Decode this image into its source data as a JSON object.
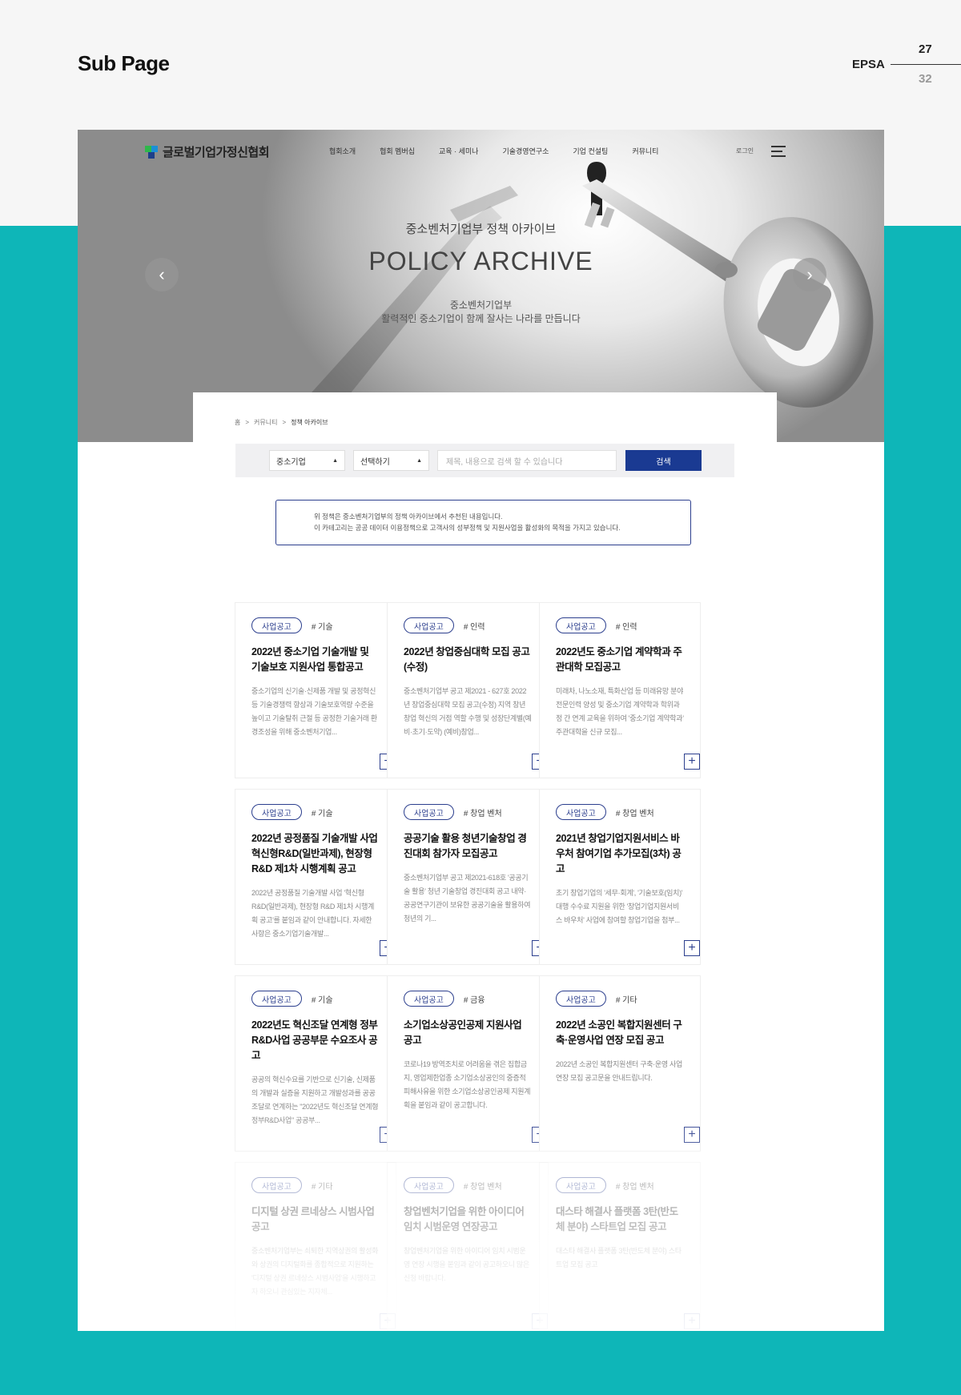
{
  "presentation": {
    "title": "Sub Page",
    "brand": "EPSA",
    "page_current": "27",
    "page_total": "32"
  },
  "site": {
    "logo": "글로벌기업가정신협회",
    "menu": [
      "협회소개",
      "협회 멤버십",
      "교육 · 세미나",
      "기술경영연구소",
      "기업 컨설팅",
      "커뮤니티"
    ],
    "login": "로그인"
  },
  "hero": {
    "subtitle": "중소벤처기업부 정책 아카이브",
    "title": "POLICY ARCHIVE",
    "desc_line1": "중소벤처기업부",
    "desc_line2": "활력적인 중소기업이 함께 잘사는 나라를 만듭니다",
    "prev": "‹",
    "next": "›"
  },
  "breadcrumb": {
    "home": "홈",
    "sep": ">",
    "level1": "커뮤니티",
    "current": "정책 아카이브"
  },
  "search": {
    "select1": "중소기업",
    "select2": "선택하기",
    "placeholder": "제목, 내용으로 검색 할 수 있습니다",
    "button": "검색"
  },
  "notice": {
    "line1": "위 정책은 중소벤처기업부의 정책 아카이브에서 추천된 내용입니다.",
    "line2": "이 카테고리는 공공 데이터 이용정책으로 고객사의 성부정책 및 지원사업을 활성화의 목적을 가지고 있습니다."
  },
  "cards": [
    {
      "tag": "사업공고",
      "hash": "# 기술",
      "title": "2022년 중소기업 기술개발 및 기술보호 지원사업 통합공고",
      "desc": "중소기업의 신기술·신제품 개발 및 공정혁신 등 기술경쟁력 향상과 기술보호역량 수준을 높이고 기술탈취 근절 등 공정한 기술거래 환경조성을 위해 중소벤처기업..."
    },
    {
      "tag": "사업공고",
      "hash": "# 인력",
      "title": "2022년 창업중심대학 모집 공고(수정)",
      "desc": "중소벤처기업부 공고 제2021 - 627호 2022년 창업중심대학 모집 공고(수정) 지역 창년창업 혁신의 거점 역할 수행 및 성장단계별(예비·초기·도약) (예비)창업..."
    },
    {
      "tag": "사업공고",
      "hash": "# 인력",
      "title": "2022년도 중소기업 계약학과 주관대학 모집공고",
      "desc": "미래차, 나노소재, 특화산업 등 미래유망 분야 전문인력 양성 및 중소기업 계약학과 학위과정 간 연계 교육을 위하여 '중소기업 계약학과' 주관대학을 신규 모집..."
    },
    {
      "tag": "사업공고",
      "hash": "# 기술",
      "title": "2022년 공정품질 기술개발 사업 혁신형R&D(일반과제), 현장형 R&D 제1차 시행계획 공고",
      "desc": "2022년 공정품질 기술개발 사업 '혁신형 R&D(일반과제), 현장형 R&D 제1차 시행계획 공고'를 붙임과 같이 안내합니다. 자세한 사항은 중소기업기술개발..."
    },
    {
      "tag": "사업공고",
      "hash": "# 창업 벤처",
      "title": "공공기술 활용 청년기술창업 경진대회 참가자 모집공고",
      "desc": "중소벤처기업부 공고 제2021-618호 '공공기술 활용' 청년 기술창업 경진대회 공고 내약·공공연구기관이 보유한 공공기술을 활용하여 청년의 기..."
    },
    {
      "tag": "사업공고",
      "hash": "# 창업 벤처",
      "title": "2021년 창업기업지원서비스 바우처 참여기업 추가모집(3차) 공고",
      "desc": "초기 창업기업의 '세무·회계', '기술보호(임치)' 대행 수수료 지원을 위한 '창업기업지원서비스 바우처' 사업에 참여할 창업기업을 첨부..."
    },
    {
      "tag": "사업공고",
      "hash": "# 기술",
      "title": "2022년도 혁신조달 연계형 정부R&D사업 공공부문 수요조사 공고",
      "desc": "공공의 혁신수요를 기반으로 신기술, 신제품의 개발과 실증을 지원하고 개발성과를 공공조달로 연계하는 \"2022년도 혁신조달 연계형 정부R&D사업\" 공공부..."
    },
    {
      "tag": "사업공고",
      "hash": "# 금융",
      "title": "소기업소상공인공제 지원사업 공고",
      "desc": "코로나19 방역조치로 어려움을 겪은 집합금지, 영업제한업종 소기업소상공인의 중증적 피해사유을 위한 소기업소상공인공제 지원계획을 붙임과 같이 공고합니다."
    },
    {
      "tag": "사업공고",
      "hash": "# 기타",
      "title": "2022년 소공인 복합지원센터 구축·운영사업 연장 모집 공고",
      "desc": "2022년 소공인 복합지원센터 구축·운영 사업 연장 모집 공고문을 안내드립니다."
    },
    {
      "tag": "사업공고",
      "hash": "# 기타",
      "title": "디지털 상권 르네상스 시범사업 공고",
      "desc": "중소벤처기업부는 쇠퇴한 지역상권의 활성화와 상권의 디지털화를 종합적으로 지원하는 '디지털 상권 르네상스 시범사업'을 시행하고자 하오니 관심있는 지자체..."
    },
    {
      "tag": "사업공고",
      "hash": "# 창업 벤처",
      "title": "창업벤처기업을 위한 아이디어 임치 시범운영 연장공고",
      "desc": "창업벤처기업을 위한 아이디어 임치 시범운영 연장 시행을 붙임과 같이 공고하오니 많은 신청 바랍니다."
    },
    {
      "tag": "사업공고",
      "hash": "# 창업 벤처",
      "title": "대스타 해결사 플랫폼 3탄(반도체 분야) 스타트업 모집 공고",
      "desc": "대스타 해결사 플랫폼 3탄(반도체 분야) 스타트업 모집 공고"
    }
  ],
  "colors": {
    "accent": "#1a3a92",
    "teal": "#0eb6b8",
    "tag_border": "#2c3f8e"
  }
}
